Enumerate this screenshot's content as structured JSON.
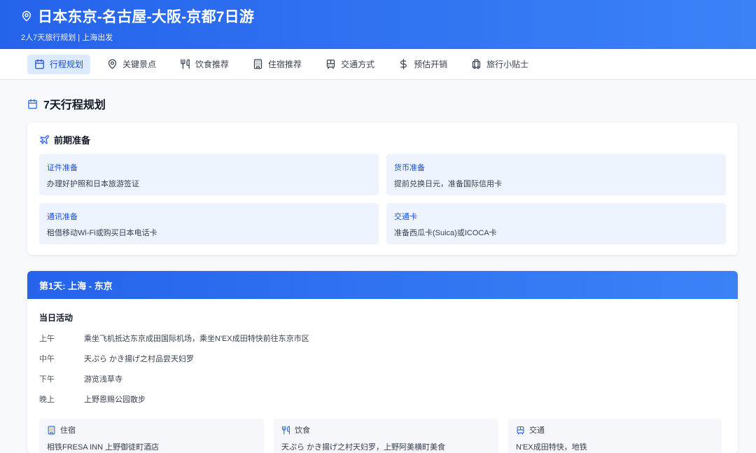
{
  "header": {
    "title": "日本东京-名古屋-大阪-京都7日游",
    "subtitle": "2人7天旅行规划 | 上海出发",
    "icon": "map-pin-icon"
  },
  "tabs": [
    {
      "label": "行程规划",
      "icon": "calendar-icon",
      "active": true
    },
    {
      "label": "关键景点",
      "icon": "map-pin-icon",
      "active": false
    },
    {
      "label": "饮食推荐",
      "icon": "utensils-icon",
      "active": false
    },
    {
      "label": "住宿推荐",
      "icon": "building-icon",
      "active": false
    },
    {
      "label": "交通方式",
      "icon": "train-icon",
      "active": false
    },
    {
      "label": "预估开销",
      "icon": "dollar-icon",
      "active": false
    },
    {
      "label": "旅行小贴士",
      "icon": "luggage-icon",
      "active": false
    }
  ],
  "section": {
    "title": "7天行程规划",
    "icon": "calendar-icon"
  },
  "prep": {
    "title": "前期准备",
    "icon": "plane-icon",
    "items": [
      {
        "label": "证件准备",
        "value": "办理好护照和日本旅游签证"
      },
      {
        "label": "货币准备",
        "value": "提前兑换日元，准备国际信用卡"
      },
      {
        "label": "通讯准备",
        "value": "租借移动Wi-Fi或购买日本电话卡"
      },
      {
        "label": "交通卡",
        "value": "准备西瓜卡(Suica)或ICOCA卡"
      }
    ]
  },
  "day1": {
    "title": "第1天: 上海 - 东京",
    "activities_title": "当日活动",
    "activities": [
      {
        "time": "上午",
        "text": "乘坐飞机抵达东京成田国际机场，乘坐N'EX成田特快前往东京市区"
      },
      {
        "time": "中午",
        "text": "天ぷら かき揚げ之村品尝天妇罗"
      },
      {
        "time": "下午",
        "text": "游览浅草寺"
      },
      {
        "time": "晚上",
        "text": "上野恩赐公园散步"
      }
    ],
    "info": [
      {
        "label": "住宿",
        "icon": "building-icon",
        "value": "相铁FRESA INN 上野御徒町酒店"
      },
      {
        "label": "饮食",
        "icon": "utensils-icon",
        "value": "天ぷら かき揚げ之村天妇罗，上野阿美横町美食"
      },
      {
        "label": "交通",
        "icon": "train-icon",
        "value": "N'EX成田特快，地铁"
      }
    ]
  },
  "colors": {
    "primary": "#2563eb",
    "tab_active_bg": "#dbeafe",
    "prep_item_bg": "#eef4fd"
  }
}
